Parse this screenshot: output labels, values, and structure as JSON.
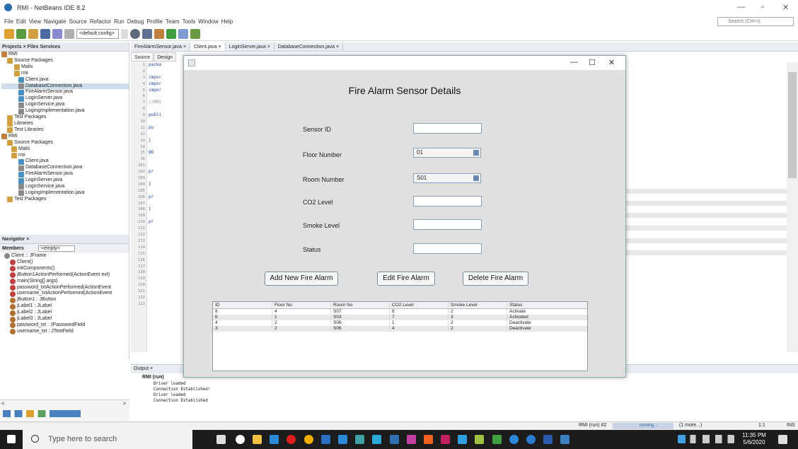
{
  "window": {
    "title": "RMI - NetBeans IDE 8.2"
  },
  "menu": [
    "File",
    "Edit",
    "View",
    "Navigate",
    "Source",
    "Refactor",
    "Run",
    "Debug",
    "Profile",
    "Team",
    "Tools",
    "Window",
    "Help"
  ],
  "toolbar": {
    "config": "<default config>"
  },
  "search": {
    "placeholder": "Search (Ctrl+I)"
  },
  "projects": {
    "tabs": "Projects × Files Services",
    "items": [
      "RMI",
      "Source Packages",
      "Mails",
      "rmi",
      "Client.java",
      "DatabaseConnection.java",
      "FireAlarmSensor.java",
      "LoginServer.java",
      "LoginService.java",
      "LogingImplementation.java",
      "Test Packages",
      "Libraries",
      "Test Libraries",
      "RMI",
      "Source Packages",
      "Mails",
      "rmi",
      "Client.java",
      "DatabaseConnection.java",
      "FireAlarmSensor.java",
      "LoginServer.java",
      "LoginService.java",
      "LogingImplementation.java",
      "Test Packages"
    ]
  },
  "navigator": {
    "tab": "Navigator ×",
    "members_label": "Members",
    "filter": "<empty>",
    "items": [
      "Client :: JFrame",
      "Client()",
      "initComponents()",
      "jButton1ActionPerformed(ActionEvent evt)",
      "main(String[] args)",
      "password_txtActionPerformed(ActionEvent",
      "username_txtActionPerformed(ActionEvent",
      "jButton1 : JButton",
      "jLabel1 : JLabel",
      "jLabel2 : JLabel",
      "jLabel3 : JLabel",
      "password_txt : JPasswordField",
      "username_txt : JTextField"
    ]
  },
  "editor": {
    "tabs": [
      "FireAlarmSensor.java ×",
      "Client.java ×",
      "LoginServer.java ×",
      "DatabaseConnection.java ×"
    ],
    "source_tab": "Source",
    "design_tab": "Design",
    "line_numbers": [
      "1",
      "2",
      "3",
      "4",
      "5",
      "6",
      "7",
      "8",
      "9",
      "10",
      "11",
      "12",
      "13",
      "14",
      "15",
      "16",
      "101",
      "102",
      "103",
      "104",
      "105",
      "106",
      "107",
      "108",
      "109",
      "110",
      "111",
      "112",
      "113",
      "114",
      "115",
      "116",
      "117",
      "118",
      "119",
      "120",
      "121",
      "122",
      "123"
    ],
    "code": [
      "packa",
      "",
      "impor",
      "impor",
      "impor",
      "",
      "//RMI",
      "",
      "publi",
      "",
      "pu",
      "",
      "}",
      "",
      "@O",
      "",
      "",
      "pr",
      "",
      "}",
      "",
      "pr",
      "",
      "}",
      "",
      "pr"
    ]
  },
  "output": {
    "tab": "Output ×",
    "run": "RMI (run)",
    "lines": [
      "Driver loaded",
      "Connection Established!",
      "Driver loaded",
      "Connection Established"
    ]
  },
  "status": {
    "run": "RMI (run) #2",
    "running": "running...",
    "more": "(1 more...)",
    "pos": "1:1",
    "mode": "INS"
  },
  "taskbar": {
    "search": "Type here to search",
    "time": "11:35 PM",
    "date": "5/6/2020"
  },
  "dialog": {
    "heading": "Fire Alarm Sensor Details",
    "labels": {
      "sensor": "Sensor ID",
      "floor": "Floor Number",
      "room": "Room Number",
      "co2": "CO2 Level",
      "smoke": "Smoke Level",
      "status": "Status"
    },
    "floor_value": "01",
    "room_value": "S01",
    "buttons": {
      "add": "Add New Fire Alarm",
      "edit": "Edit Fire Alarm",
      "delete": "Delete Fire Alarm"
    },
    "table": {
      "headers": [
        "ID",
        "Floor No",
        "Room No",
        "CO2 Level",
        "Smoke Level",
        "Status"
      ],
      "rows": [
        [
          "8",
          "4",
          "S07",
          "8",
          "2",
          "Activate"
        ],
        [
          "6",
          "1",
          "S03",
          "7",
          "3",
          "Activated"
        ],
        [
          "4",
          "2",
          "S06",
          "1",
          "2",
          "Deactivate"
        ],
        [
          "3",
          "2",
          "S06",
          "4",
          "2",
          "Deactivate"
        ]
      ]
    }
  }
}
